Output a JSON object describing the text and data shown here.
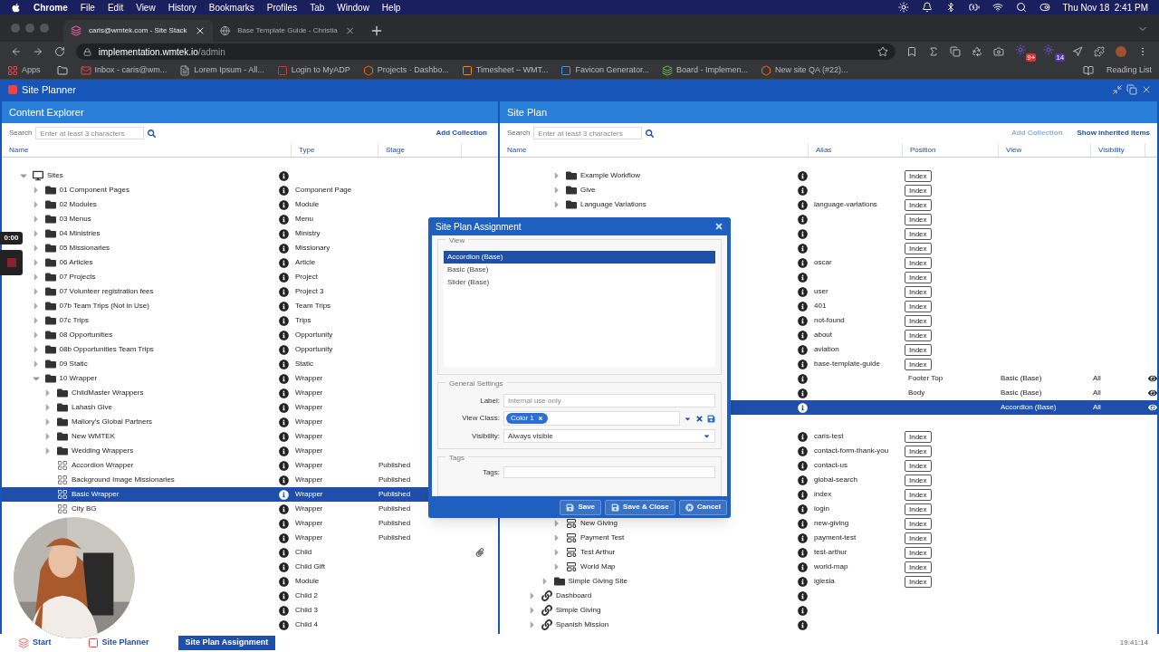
{
  "mac_menu": {
    "app": "Chrome",
    "items": [
      "File",
      "Edit",
      "View",
      "History",
      "Bookmarks",
      "Profiles",
      "Tab",
      "Window",
      "Help"
    ],
    "clock": "Thu Nov 18  2:41 PM"
  },
  "browser": {
    "tabs": [
      {
        "title": "caris@wmtek.com - Site Stack",
        "selected": true
      },
      {
        "title": "Base Template Guide - Christia",
        "selected": false
      }
    ],
    "url_host": "implementation.wmtek.io",
    "url_path": "/admin",
    "extension_badges": [
      "9+",
      "14"
    ],
    "bookmarks": [
      "Apps",
      "Inbox - caris@wm...",
      "Lorem Ipsum - All...",
      "Login to MyADP",
      "Projects · Dashbo...",
      "Timesheet – WMT...",
      "Favicon Generator...",
      "Board - Implemen...",
      "New site QA (#22)..."
    ],
    "reading_list": "Reading List"
  },
  "app": {
    "title": "Site Planner"
  },
  "content_explorer": {
    "title": "Content Explorer",
    "search_label": "Search",
    "search_placeholder": "Enter at least 3 characters",
    "add_collection": "Add Collection",
    "columns": [
      "Name",
      "Type",
      "Stage"
    ],
    "tree": [
      {
        "name": "Sites",
        "kind": "monitor",
        "expanded": true,
        "info": true,
        "selected": false,
        "children": [
          {
            "name": "01 Component Pages",
            "kind": "folder",
            "expanded": false,
            "info": true,
            "type": "Component Page",
            "selected": false
          },
          {
            "name": "02 Modules",
            "kind": "folder",
            "expanded": false,
            "info": true,
            "type": "Module",
            "selected": false
          },
          {
            "name": "03 Menus",
            "kind": "folder",
            "expanded": false,
            "info": true,
            "type": "Menu",
            "selected": false
          },
          {
            "name": "04 Ministries",
            "kind": "folder",
            "expanded": false,
            "info": true,
            "type": "Ministry",
            "selected": false
          },
          {
            "name": "05 Missionaries",
            "kind": "folder",
            "expanded": false,
            "info": true,
            "type": "Missionary",
            "selected": false
          },
          {
            "name": "06 Articles",
            "kind": "folder",
            "expanded": false,
            "info": true,
            "type": "Article",
            "selected": false
          },
          {
            "name": "07 Projects",
            "kind": "folder",
            "expanded": false,
            "info": true,
            "type": "Project",
            "selected": false
          },
          {
            "name": "07 Volunteer registration fees",
            "kind": "folder",
            "expanded": false,
            "info": true,
            "type": "Project 3",
            "selected": false
          },
          {
            "name": "07b Team Trips (Not in Use)",
            "kind": "folder",
            "expanded": false,
            "info": true,
            "type": "Team Trips",
            "selected": false
          },
          {
            "name": "07c Trips",
            "kind": "folder",
            "expanded": false,
            "info": true,
            "type": "Trips",
            "selected": false
          },
          {
            "name": "08 Opportunities",
            "kind": "folder",
            "expanded": false,
            "info": true,
            "type": "Opportunity",
            "selected": false
          },
          {
            "name": "08b Opportunities Team Trips",
            "kind": "folder",
            "expanded": false,
            "info": true,
            "type": "Opportunity",
            "selected": false
          },
          {
            "name": "09 Static",
            "kind": "folder",
            "expanded": false,
            "info": true,
            "type": "Static",
            "selected": false
          },
          {
            "name": "10 Wrapper",
            "kind": "folder",
            "expanded": true,
            "info": true,
            "type": "Wrapper",
            "selected": false,
            "children": [
              {
                "name": "ChildMaster Wrappers",
                "kind": "folder",
                "expanded": false,
                "info": true,
                "type": "Wrapper",
                "selected": false
              },
              {
                "name": "Lahash Give",
                "kind": "folder",
                "expanded": false,
                "info": true,
                "type": "Wrapper",
                "selected": false
              },
              {
                "name": "Mallory's Global Partners",
                "kind": "folder",
                "expanded": false,
                "info": true,
                "type": "Wrapper",
                "selected": false
              },
              {
                "name": "New WMTEK",
                "kind": "folder",
                "expanded": false,
                "info": true,
                "type": "Wrapper",
                "selected": false
              },
              {
                "name": "Wedding Wrappers",
                "kind": "folder",
                "expanded": false,
                "info": true,
                "type": "Wrapper",
                "selected": false
              },
              {
                "name": "Accordion Wrapper",
                "kind": "grid",
                "info": true,
                "type": "Wrapper",
                "stage": "Published",
                "selected": false
              },
              {
                "name": "Background Image Missionaries",
                "kind": "grid",
                "info": true,
                "type": "Wrapper",
                "stage": "Published",
                "selected": false
              },
              {
                "name": "Basic Wrapper",
                "kind": "grid",
                "info": true,
                "type": "Wrapper",
                "stage": "Published",
                "selected": true
              },
              {
                "name": "City BG",
                "kind": "grid",
                "info": true,
                "type": "Wrapper",
                "stage": "Published",
                "selected": false
              },
              {
                "kind": "row",
                "info": true,
                "type": "Wrapper",
                "stage": "Published",
                "selected": false
              },
              {
                "kind": "row",
                "info": true,
                "type": "Wrapper",
                "stage": "Published",
                "selected": false
              }
            ]
          },
          {
            "kind": "row",
            "info": true,
            "type": "Child",
            "attachment": true,
            "selected": false
          },
          {
            "kind": "row",
            "info": true,
            "type": "Child Gift",
            "selected": false
          },
          {
            "kind": "row",
            "info": true,
            "type": "Module",
            "selected": false
          },
          {
            "kind": "row",
            "info": true,
            "type": "Child 2",
            "selected": false
          },
          {
            "kind": "row",
            "info": true,
            "type": "Child 3",
            "selected": false
          },
          {
            "kind": "row",
            "info": true,
            "type": "Child 4",
            "selected": false
          }
        ]
      }
    ]
  },
  "site_plan": {
    "title": "Site Plan",
    "search_label": "Search",
    "search_placeholder": "Enter at least 3 characters",
    "add_collection": "Add Collection",
    "add_collection_disabled": true,
    "show_inherited": "Show inherited items",
    "columns": [
      "Name",
      "Alias",
      "Position",
      "View",
      "Visibility"
    ],
    "tree": [
      {
        "kind": "group",
        "children": [
          {
            "kind": "group",
            "children": [
              {
                "kind": "folder",
                "name": "Example Workflow",
                "expanded": false,
                "info": true,
                "index": "Index",
                "selected": false
              },
              {
                "kind": "folder",
                "name": "Give",
                "expanded": false,
                "info": true,
                "index": "Index",
                "selected": false
              },
              {
                "kind": "folder",
                "name": "Language Variations",
                "expanded": false,
                "info": true,
                "alias": "language-variations",
                "index": "Index",
                "selected": false
              },
              {
                "kind": "row",
                "info": true,
                "index": "Index",
                "selected": false
              },
              {
                "kind": "row",
                "info": true,
                "index": "Index",
                "selected": false
              },
              {
                "kind": "row",
                "info": true,
                "index": "Index",
                "selected": false
              },
              {
                "kind": "row",
                "info": true,
                "alias": "oscar",
                "index": "Index",
                "selected": false
              },
              {
                "kind": "row",
                "info": true,
                "index": "Index",
                "selected": false
              },
              {
                "kind": "row",
                "info": true,
                "alias": "user",
                "index": "Index",
                "selected": false
              },
              {
                "kind": "row",
                "info": true,
                "alias": "401",
                "index": "Index",
                "selected": false
              },
              {
                "kind": "row",
                "info": true,
                "alias": "not-found",
                "index": "Index",
                "selected": false
              },
              {
                "kind": "row",
                "info": true,
                "alias": "about",
                "index": "Index",
                "selected": false
              },
              {
                "kind": "row",
                "info": true,
                "alias": "aviation",
                "index": "Index",
                "selected": false
              },
              {
                "kind": "row",
                "info": true,
                "alias": "base-template-guide",
                "index": "Index",
                "selected": false
              },
              {
                "kind": "row",
                "info": true,
                "position": "Footer Top",
                "view": "Basic (Base)",
                "visibility": "All",
                "visible": true,
                "selected": false
              },
              {
                "kind": "row",
                "info": true,
                "position": "Body",
                "view": "Basic (Base)",
                "visibility": "All",
                "visible": true,
                "selected": false
              },
              {
                "kind": "row",
                "info": true,
                "view": "Accordion (Base)",
                "visibility": "All",
                "visible": true,
                "selected": true
              },
              {
                "kind": "row",
                "info": false,
                "selected": false
              },
              {
                "kind": "row",
                "info": true,
                "alias": "caris-test",
                "index": "Index",
                "selected": false
              },
              {
                "kind": "row",
                "info": true,
                "alias": "contact-form-thank-you",
                "index": "Index",
                "selected": false
              },
              {
                "kind": "row",
                "info": true,
                "alias": "contact-us",
                "index": "Index",
                "selected": false
              },
              {
                "kind": "row",
                "info": true,
                "alias": "global-search",
                "index": "Index",
                "selected": false
              },
              {
                "kind": "row",
                "info": true,
                "alias": "index",
                "index": "Index",
                "selected": false
              },
              {
                "kind": "row",
                "info": true,
                "alias": "login",
                "index": "Index",
                "selected": false
              },
              {
                "kind": "page",
                "name": "New Giving",
                "expanded": false,
                "info": true,
                "alias": "new-giving",
                "index": "Index",
                "selected": false
              },
              {
                "kind": "page",
                "name": "Payment Test",
                "expanded": false,
                "info": true,
                "alias": "payment-test",
                "index": "Index",
                "selected": false
              },
              {
                "kind": "page",
                "name": "Test Arthur",
                "expanded": false,
                "info": true,
                "alias": "test-arthur",
                "index": "Index",
                "selected": false
              },
              {
                "kind": "page",
                "name": "World Map",
                "expanded": false,
                "info": true,
                "alias": "world-map",
                "index": "Index",
                "selected": false
              }
            ]
          },
          {
            "kind": "folder",
            "name": "Simple Giving Site",
            "expanded": false,
            "info": true,
            "alias": "iglesia",
            "index": "Index",
            "selected": false
          }
        ]
      },
      {
        "kind": "link",
        "name": "Dashboard",
        "expanded": false,
        "info": true,
        "selected": false
      },
      {
        "kind": "link",
        "name": "Simple Giving",
        "expanded": false,
        "info": true,
        "selected": false
      },
      {
        "kind": "link",
        "name": "Spanish Mission",
        "expanded": false,
        "info": true,
        "selected": false
      }
    ]
  },
  "dialog": {
    "title": "Site Plan Assignment",
    "view_legend": "View",
    "views": [
      {
        "label": "Accordion (Base)",
        "selected": true
      },
      {
        "label": "Basic (Base)",
        "selected": false
      },
      {
        "label": "Slider (Base)",
        "selected": false
      }
    ],
    "general_legend": "General Settings",
    "label_label": "Label:",
    "label_placeholder": "Internal use only",
    "view_class_label": "View Class:",
    "view_class_chips": [
      "Color 1"
    ],
    "visibility_label": "Visibility:",
    "visibility_value": "Always visible",
    "tags_legend": "Tags",
    "tags_label": "Tags:",
    "buttons": [
      {
        "label": "Save",
        "kind": "save"
      },
      {
        "label": "Save & Close",
        "kind": "save"
      },
      {
        "label": "Cancel",
        "kind": "cancel"
      }
    ]
  },
  "recording": {
    "time": "0:00"
  },
  "taskbar": {
    "items": [
      {
        "label": "Start",
        "kind": "start",
        "selected": false
      },
      {
        "label": "Site Planner",
        "kind": "app",
        "selected": false
      },
      {
        "label": "Site Plan Assignment",
        "kind": "window",
        "selected": true
      }
    ],
    "clock": "19:41:14"
  }
}
